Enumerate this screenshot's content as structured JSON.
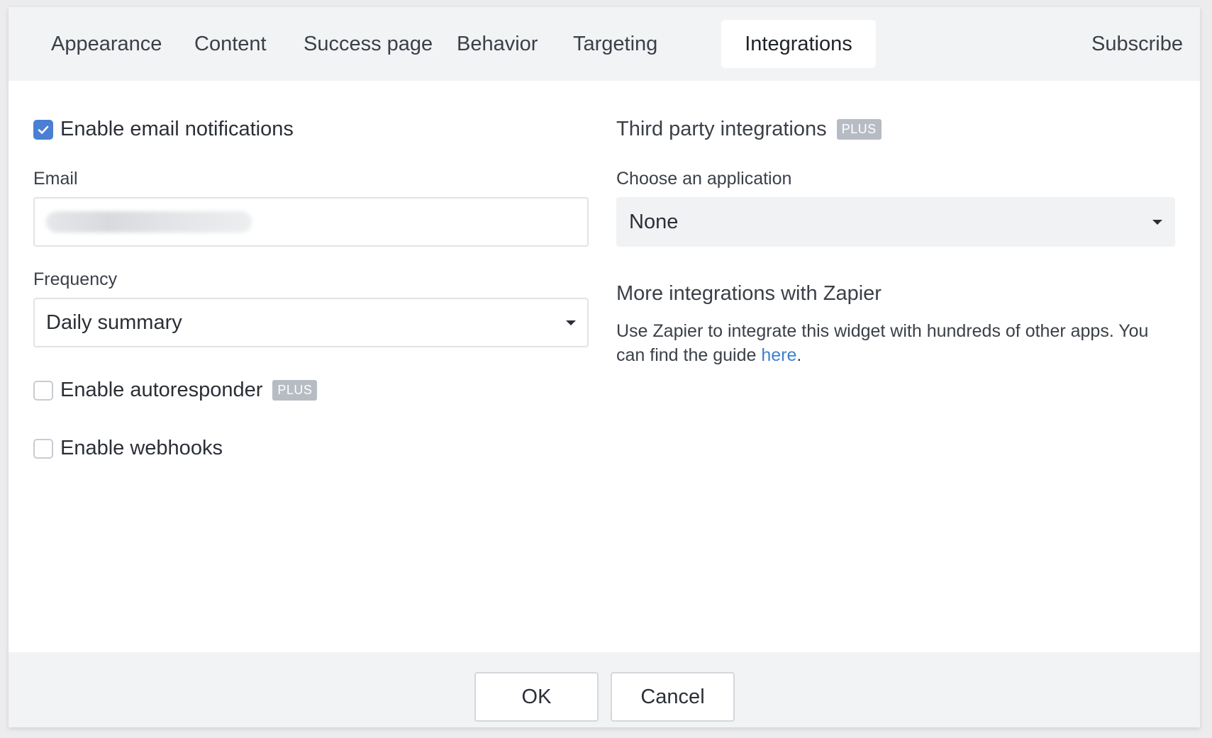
{
  "tabs": [
    {
      "label": "Appearance"
    },
    {
      "label": "Content"
    },
    {
      "label": "Success page"
    },
    {
      "label": "Behavior"
    },
    {
      "label": "Targeting"
    },
    {
      "label": "Integrations",
      "active": true
    }
  ],
  "tab_right": "Subscribe",
  "left": {
    "email_notifications_label": "Enable email notifications",
    "email_notifications_checked": true,
    "email_label": "Email",
    "frequency_label": "Frequency",
    "frequency_value": "Daily summary",
    "autoresponder_label": "Enable autoresponder",
    "autoresponder_badge": "PLUS",
    "autoresponder_checked": false,
    "webhooks_label": "Enable webhooks",
    "webhooks_checked": false
  },
  "right": {
    "third_party_title": "Third party integrations",
    "third_party_badge": "PLUS",
    "choose_label": "Choose an application",
    "application_value": "None",
    "zapier_title": "More integrations with Zapier",
    "zapier_text": "Use Zapier to integrate this widget with hundreds of other apps. You can find the guide ",
    "zapier_link": "here",
    "zapier_text_end": "."
  },
  "footer": {
    "ok_label": "OK",
    "cancel_label": "Cancel"
  },
  "colors": {
    "accent": "#4a7fd4",
    "link": "#3f7fcf",
    "badge": "#b7bcc4"
  }
}
